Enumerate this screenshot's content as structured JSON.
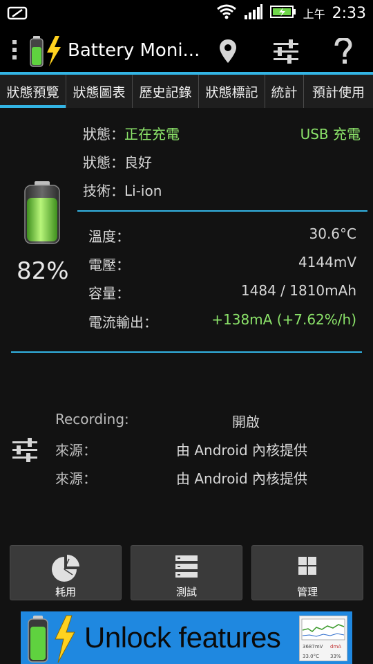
{
  "status_bar": {
    "ampm": "上午",
    "time": "2:33"
  },
  "action_bar": {
    "title": "Battery Moni..."
  },
  "tabs": [
    {
      "label": "狀態預覽",
      "active": true
    },
    {
      "label": "狀態圖表",
      "active": false
    },
    {
      "label": "歷史記錄",
      "active": false
    },
    {
      "label": "狀態標記",
      "active": false
    },
    {
      "label": "統計",
      "active": false
    },
    {
      "label": "預計使用",
      "active": false
    }
  ],
  "overview": {
    "battery_percent": "82%",
    "battery_level": 0.82,
    "status_label": "狀態：",
    "status_value": "正在充電",
    "charge_source": "USB 充電",
    "health_label": "狀態：",
    "health_value": "良好",
    "tech_label": "技術：",
    "tech_value": "Li-ion",
    "details": [
      {
        "label": "溫度：",
        "value": "30.6°C"
      },
      {
        "label": "電壓：",
        "value": "4144mV"
      },
      {
        "label": "容量：",
        "value": "1484 / 1810mAh"
      },
      {
        "label": "電流輸出：",
        "value": "+138mA (+7.62%/h)"
      }
    ]
  },
  "recording": {
    "rows": [
      {
        "label": "Recording:",
        "value": "開啟"
      },
      {
        "label": "來源：",
        "value": "由 Android 內核提供"
      },
      {
        "label": "來源：",
        "value": "由 Android 內核提供"
      }
    ]
  },
  "buttons": [
    {
      "label": "耗用",
      "icon": "pie-chart-icon"
    },
    {
      "label": "測試",
      "icon": "list-icon"
    },
    {
      "label": "管理",
      "icon": "grid-icon"
    }
  ],
  "banner": {
    "text": "Unlock features",
    "mini_readout": "3687mV",
    "mini_current": "dmA",
    "mini_temp": "33.0°C",
    "mini_pct": "33%"
  },
  "colors": {
    "accent": "#33b5e5",
    "charging_green": "#8ce46a",
    "banner_blue": "#1f88e0"
  }
}
